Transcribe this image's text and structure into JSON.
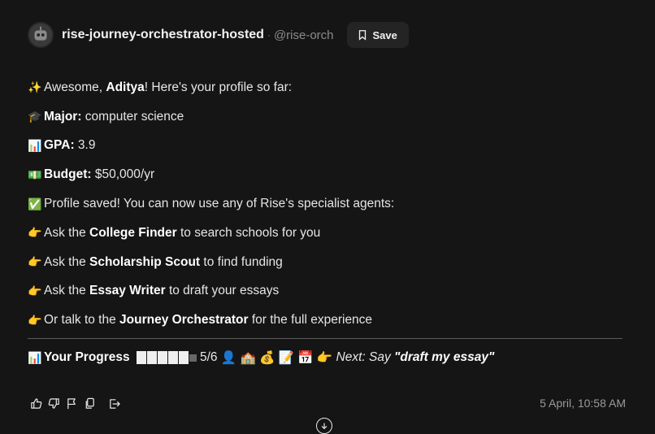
{
  "header": {
    "app_name": "rise-journey-orchestrator-hosted",
    "separator": "·",
    "handle": "@rise-orch",
    "save_label": "Save",
    "avatar_icon": "robot-avatar-icon"
  },
  "message": {
    "greeting": {
      "emoji": "✨",
      "pre": "Awesome, ",
      "name": "Aditya",
      "post": "! Here's your profile so far:"
    },
    "major": {
      "emoji": "🎓",
      "label": "Major:",
      "value": " computer science"
    },
    "gpa": {
      "emoji": "📊",
      "label": "GPA:",
      "value": " 3.9"
    },
    "budget": {
      "emoji": "💵",
      "label": "Budget:",
      "value": " $50,000/yr"
    },
    "saved": {
      "emoji": "✅",
      "text": "Profile saved! You can now use any of Rise's specialist agents:"
    },
    "agents": [
      {
        "emoji": "👉",
        "pre": "Ask the ",
        "name": "College Finder",
        "post": " to search schools for you"
      },
      {
        "emoji": "👉",
        "pre": "Ask the ",
        "name": "Scholarship Scout",
        "post": " to find funding"
      },
      {
        "emoji": "👉",
        "pre": "Ask the ",
        "name": "Essay Writer",
        "post": " to draft your essays"
      },
      {
        "emoji": "👉",
        "pre": "Or talk to the ",
        "name": "Journey Orchestrator",
        "post": " for the full experience"
      }
    ]
  },
  "progress": {
    "emoji": "📊",
    "label": "Your Progress",
    "completed": 5,
    "total": 6,
    "count_text": "5/6",
    "step_icons": "👤 🏫 💰 📝 📅",
    "pointer": "👉",
    "next_label": "Next: Say ",
    "next_command": "\"draft my essay\""
  },
  "footer": {
    "timestamp": "5 April, 10:58 AM",
    "actions": [
      "thumbs-up-icon",
      "thumbs-down-icon",
      "flag-icon",
      "copy-icon",
      "share-icon"
    ]
  },
  "colors": {
    "background": "#151515",
    "text": "#e6e6e6",
    "muted": "#9a9a9a",
    "button": "#242424"
  }
}
